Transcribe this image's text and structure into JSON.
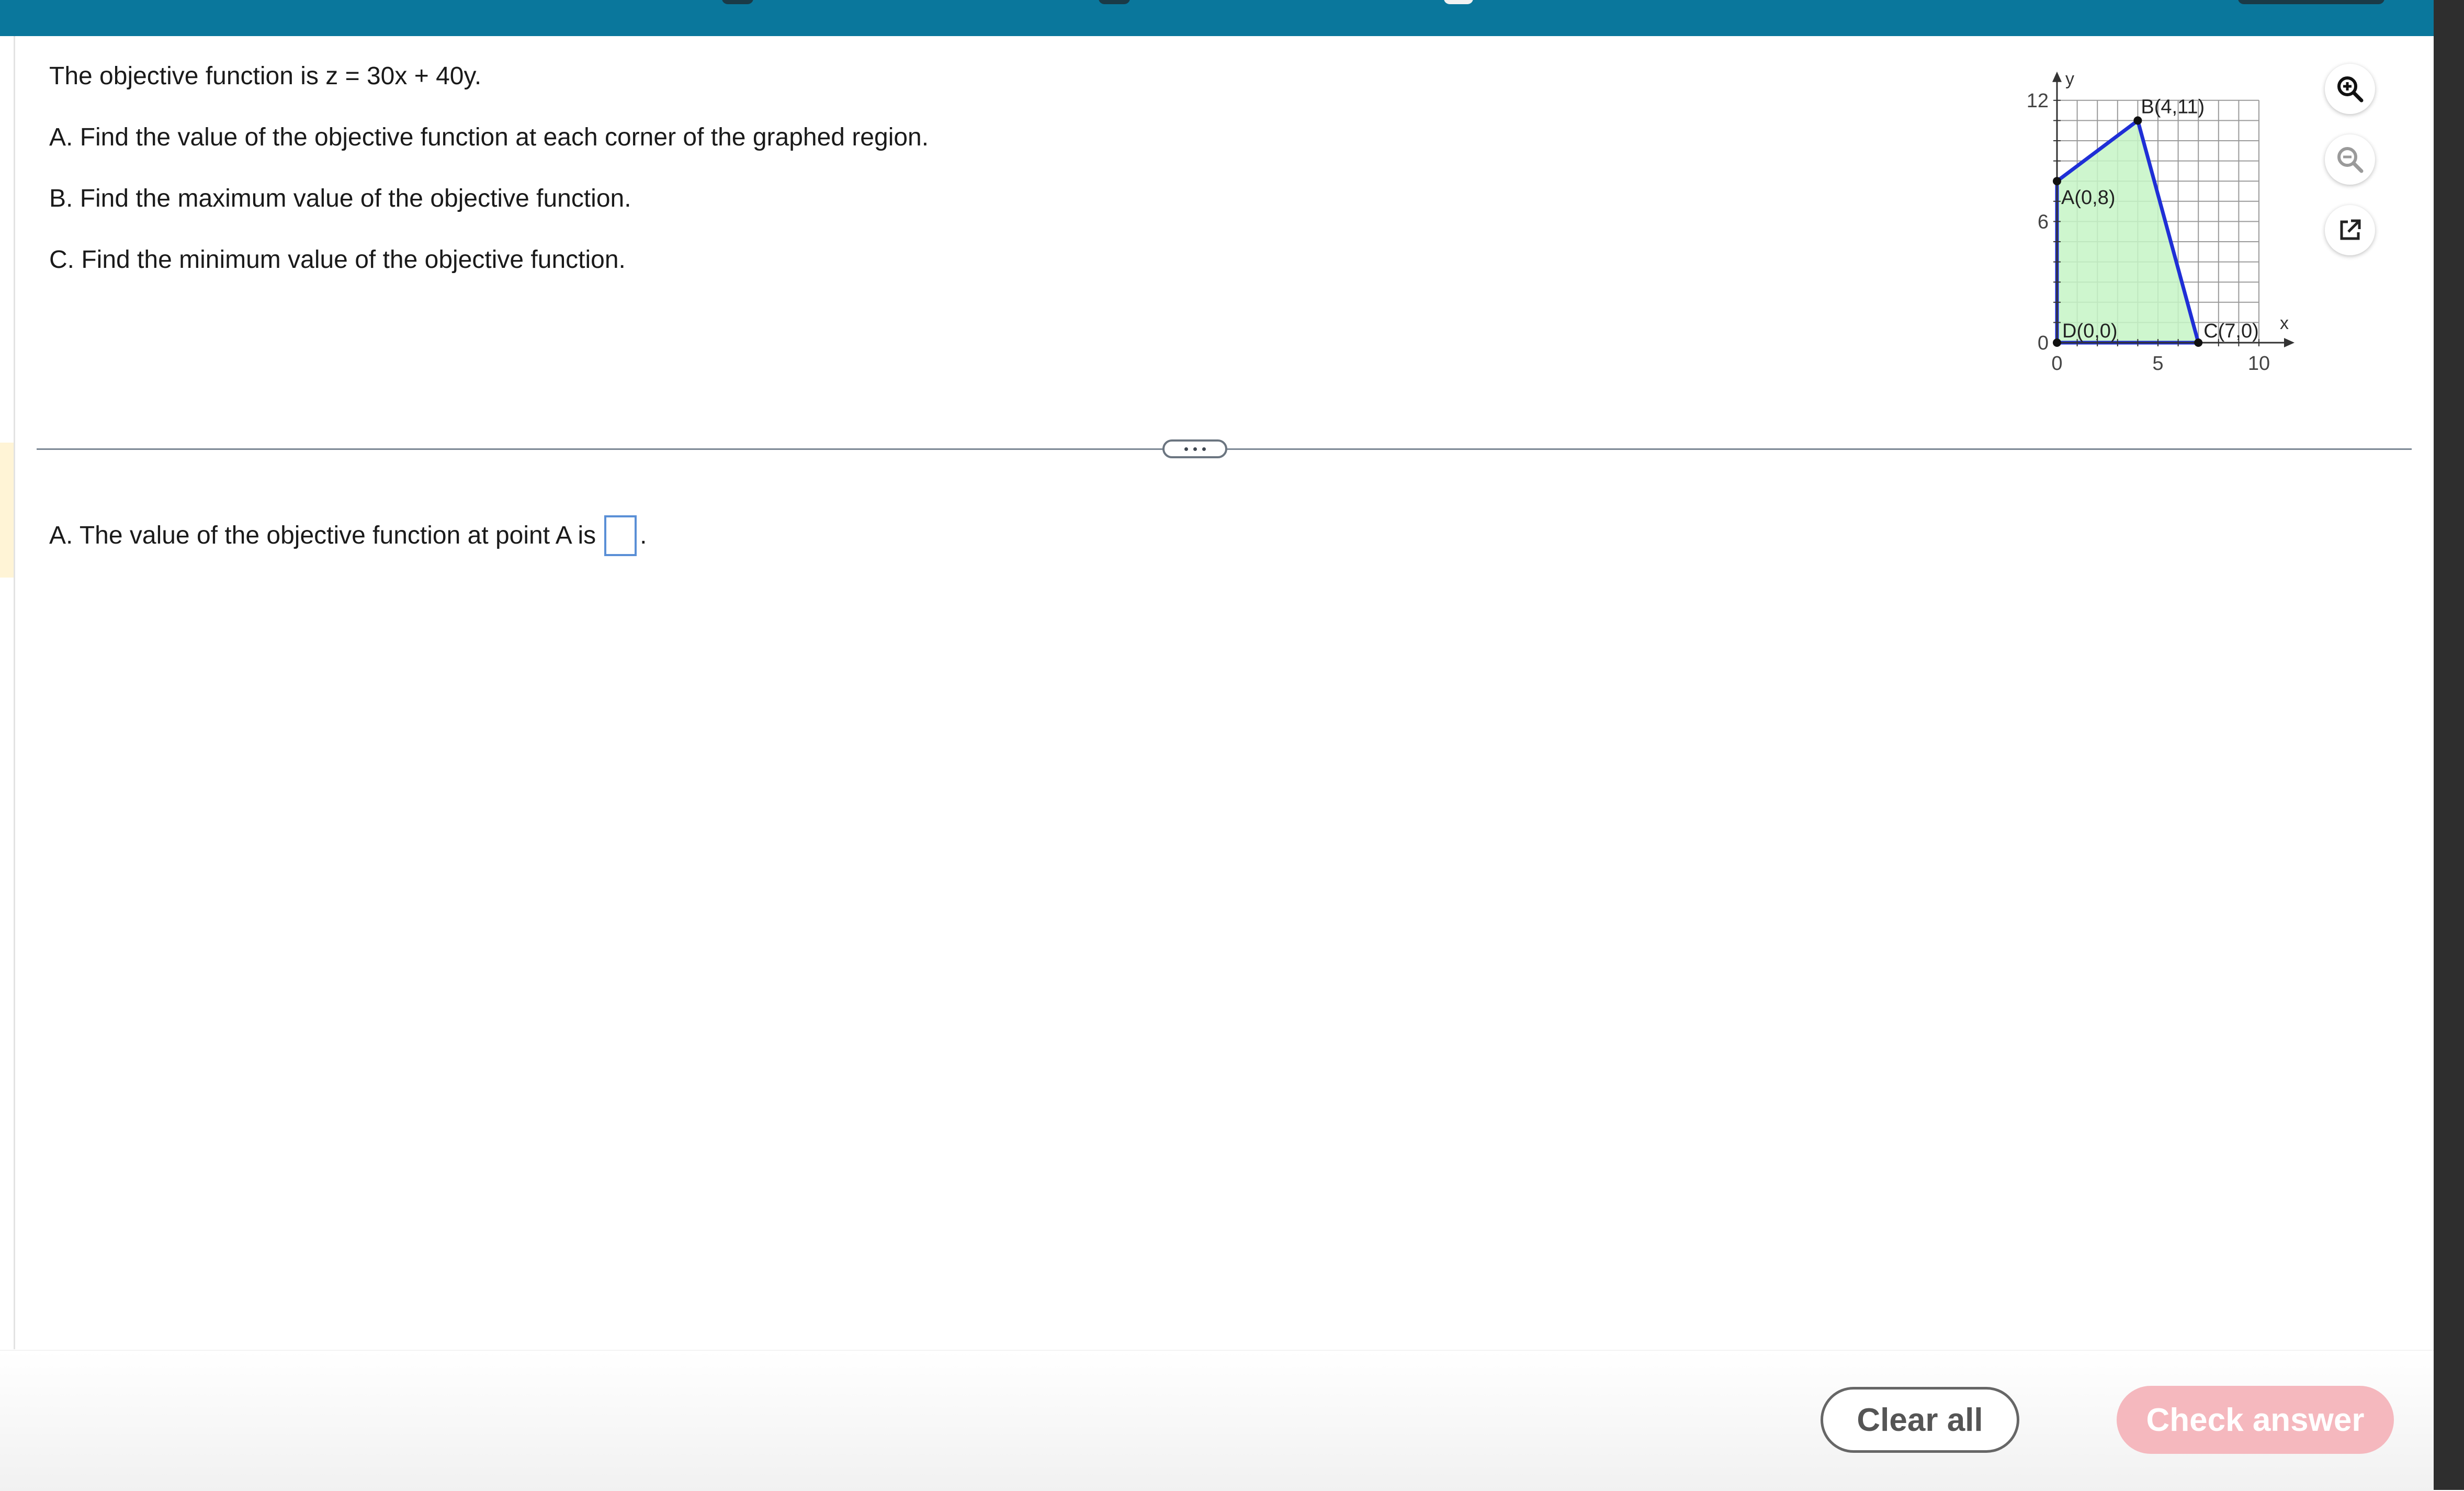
{
  "question": {
    "intro": "The objective function is z = 30x + 40y.",
    "part_a": "A. Find the value of the objective function at each corner of the graphed region.",
    "part_b": "B. Find the maximum value of the objective function.",
    "part_c": "C. Find the minimum value of the objective function."
  },
  "graph": {
    "x_axis_label": "x",
    "y_axis_label": "y",
    "x_ticks": [
      "0",
      "5",
      "10"
    ],
    "y_ticks": [
      "0",
      "6",
      "12"
    ],
    "points": [
      {
        "label": "A(0,8)",
        "x": 0,
        "y": 8
      },
      {
        "label": "B(4,11)",
        "x": 4,
        "y": 11
      },
      {
        "label": "C(7,0)",
        "x": 7,
        "y": 0
      },
      {
        "label": "D(0,0)",
        "x": 0,
        "y": 0
      }
    ],
    "fill_color": "#c6f5c6",
    "edge_color": "#1f2fd6"
  },
  "tools": {
    "zoom_in_icon": "zoom-in-icon",
    "zoom_out_icon": "zoom-out-icon",
    "popout_icon": "external-link-icon"
  },
  "answer": {
    "prefix": "A. The value of the objective function at point A is",
    "value": "",
    "suffix": "."
  },
  "footer": {
    "clear_all": "Clear all",
    "check_answer": "Check answer"
  },
  "colors": {
    "topbar": "#0a779c",
    "check_answer_bg": "#f5b8be",
    "answer_box_border": "#5a8fd6"
  }
}
